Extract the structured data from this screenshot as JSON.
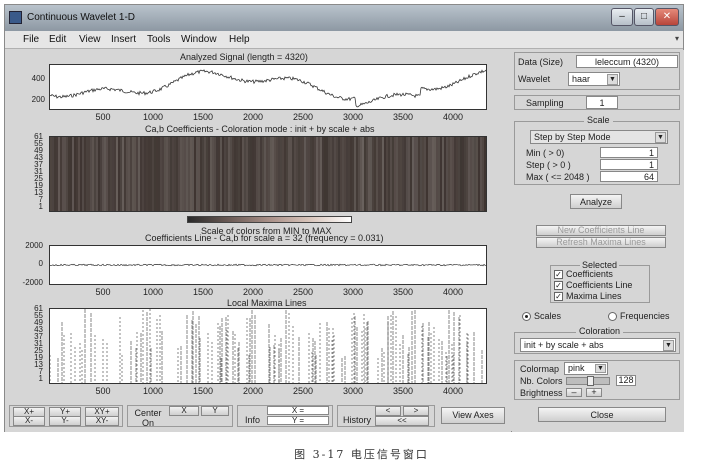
{
  "window": {
    "title": "Continuous Wavelet 1-D",
    "controls": [
      "–",
      "□",
      "✕"
    ]
  },
  "menu": {
    "items": [
      "File",
      "Edit",
      "View",
      "Insert",
      "Tools",
      "Window",
      "Help"
    ]
  },
  "plots": {
    "signal": {
      "title": "Analyzed Signal  (length = 4320)",
      "yticks": [
        "400",
        "200"
      ],
      "xticks": [
        "500",
        "1000",
        "1500",
        "2000",
        "2500",
        "3000",
        "3500",
        "4000"
      ]
    },
    "coefs": {
      "title": "Ca,b Coefficients - Coloration mode : init + by scale + abs",
      "yticks": [
        "61",
        "55",
        "49",
        "43",
        "37",
        "31",
        "25",
        "19",
        "13",
        "7",
        "1"
      ],
      "xticks": [
        "500",
        "1000",
        "1500",
        "2000",
        "2500",
        "3000",
        "3500",
        "4000"
      ]
    },
    "colorbar": {
      "label": "Scale of colors from MIN to MAX"
    },
    "line": {
      "title": "Coefficients Line - Ca,b for scale a = 32  (frequency =  0.031)",
      "yticks": [
        "2000",
        "0",
        "-2000"
      ],
      "xticks": [
        "500",
        "1000",
        "1500",
        "2000",
        "2500",
        "3000",
        "3500",
        "4000"
      ]
    },
    "maxima": {
      "title": "Local Maxima Lines",
      "yticks": [
        "61",
        "55",
        "49",
        "43",
        "37",
        "31",
        "25",
        "19",
        "13",
        "7",
        "1"
      ],
      "xticks": [
        "500",
        "1000",
        "1500",
        "2000",
        "2500",
        "3000",
        "3500",
        "4000"
      ]
    }
  },
  "panel": {
    "data_label": "Data  (Size)",
    "data_value": "leleccum  (4320)",
    "wavelet_label": "Wavelet",
    "wavelet_value": "haar",
    "sampling_label": "Sampling",
    "sampling_value": "1",
    "scale_title": "Scale",
    "scale_mode": "Step by Step Mode",
    "min_label": "Min  ( > 0)",
    "min_value": "1",
    "step_label": "Step ( > 0 )",
    "step_value": "1",
    "max_label": "Max  ( <= 2048 )",
    "max_value": "64",
    "analyze": "Analyze",
    "new_coef_line": "New Coefficients Line",
    "refresh_maxima": "Refresh Maxima Lines",
    "selected_title": "Selected",
    "chk_coefficients": "Coefficients",
    "chk_coef_line": "Coefficients Line",
    "chk_maxima": "Maxima Lines",
    "radio_scales": "Scales",
    "radio_frequencies": "Frequencies",
    "coloration_title": "Coloration",
    "coloration_value": "init + by scale + abs",
    "colormap_label": "Colormap",
    "colormap_value": "pink",
    "nbcolors_label": "Nb. Colors",
    "nbcolors_value": "128",
    "brightness_label": "Brightness",
    "brightness_minus": "–",
    "brightness_plus": "+",
    "close": "Close"
  },
  "toolbar": {
    "xplus": "X+",
    "yplus": "Y+",
    "xyplus": "XY+",
    "xminus": "X-",
    "yminus": "Y-",
    "xyminus": "XY-",
    "center_label": "Center On",
    "center_x": "X",
    "center_y": "Y",
    "info_label": "Info",
    "info_x": "X =",
    "info_y": "Y =",
    "history_label": "History",
    "hist_back": "<",
    "hist_fwd": ">",
    "hist_first": "<<",
    "view_axes": "View Axes"
  },
  "caption": "图 3-17   电压信号窗口"
}
